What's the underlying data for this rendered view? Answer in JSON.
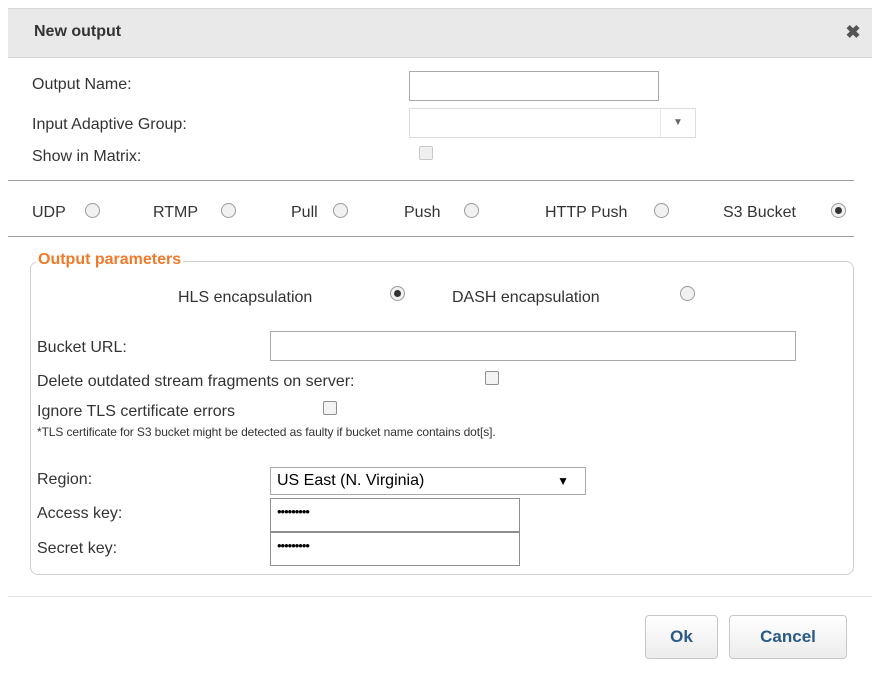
{
  "dialog": {
    "title": "New output",
    "close_icon": "close-icon"
  },
  "form": {
    "output_name_label": "Output Name:",
    "output_name_value": "",
    "input_adaptive_group_label": "Input Adaptive Group:",
    "input_adaptive_group_value": "",
    "show_in_matrix_label": "Show in Matrix:",
    "show_in_matrix_checked": false
  },
  "output_types": [
    {
      "label": "UDP",
      "selected": false
    },
    {
      "label": "RTMP",
      "selected": false
    },
    {
      "label": "Pull",
      "selected": false
    },
    {
      "label": "Push",
      "selected": false
    },
    {
      "label": "HTTP Push",
      "selected": false
    },
    {
      "label": "S3 Bucket",
      "selected": true
    }
  ],
  "params": {
    "legend": "Output parameters",
    "hls_label": "HLS encapsulation",
    "hls_selected": true,
    "dash_label": "DASH encapsulation",
    "dash_selected": false,
    "bucket_url_label": "Bucket URL:",
    "bucket_url_value": "",
    "delete_fragments_label": "Delete outdated stream fragments on server:",
    "delete_fragments_checked": false,
    "ignore_tls_label": "Ignore TLS certificate errors",
    "ignore_tls_checked": false,
    "tls_note": "*TLS certificate for S3 bucket might be detected as faulty if bucket name contains dot[s].",
    "region_label": "Region:",
    "region_value": "US East (N. Virginia)",
    "access_key_label": "Access key:",
    "access_key_masked": "•••••••••",
    "secret_key_label": "Secret key:",
    "secret_key_masked": "•••••••••"
  },
  "footer": {
    "ok_label": "Ok",
    "cancel_label": "Cancel"
  },
  "colors": {
    "legend": "#ef7a2a",
    "button_text": "#2a5a86",
    "titlebar": "#e9e9e9"
  }
}
